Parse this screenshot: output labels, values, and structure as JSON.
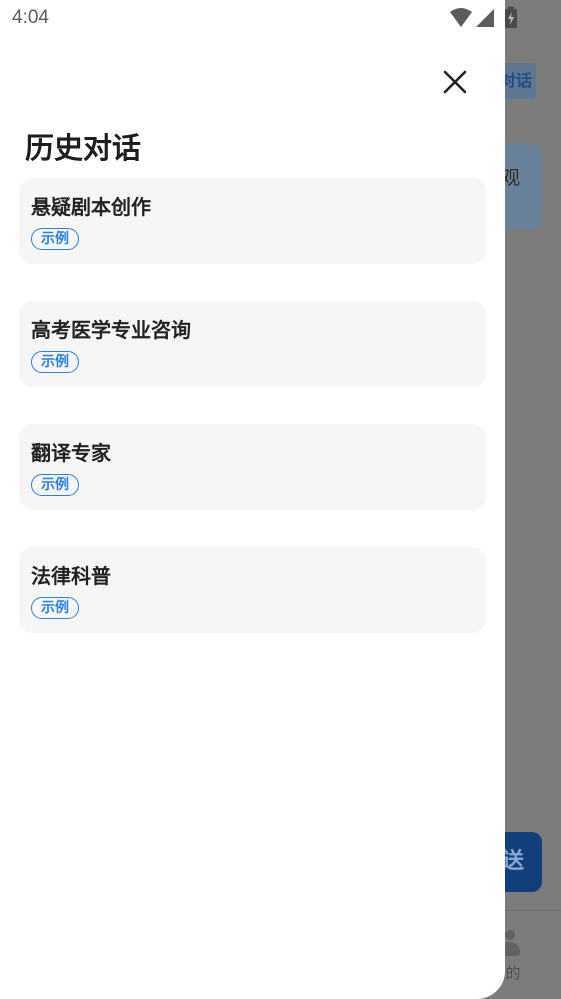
{
  "status_bar": {
    "time": "4:04"
  },
  "drawer": {
    "title": "历史对话",
    "close_icon": "close-icon",
    "items": [
      {
        "title": "悬疑剧本创作",
        "tag": "示例"
      },
      {
        "title": "高考医学专业咨询",
        "tag": "示例"
      },
      {
        "title": "翻译专家",
        "tag": "示例"
      },
      {
        "title": "法律科普",
        "tag": "示例"
      }
    ]
  },
  "background": {
    "top_button_label": "对话",
    "card_text": "观",
    "send_label": "送",
    "tab_label": "的"
  },
  "colors": {
    "accent": "#2a7fe3",
    "card_bg": "#f6f6f6",
    "scrim": "#7c7c7c"
  }
}
